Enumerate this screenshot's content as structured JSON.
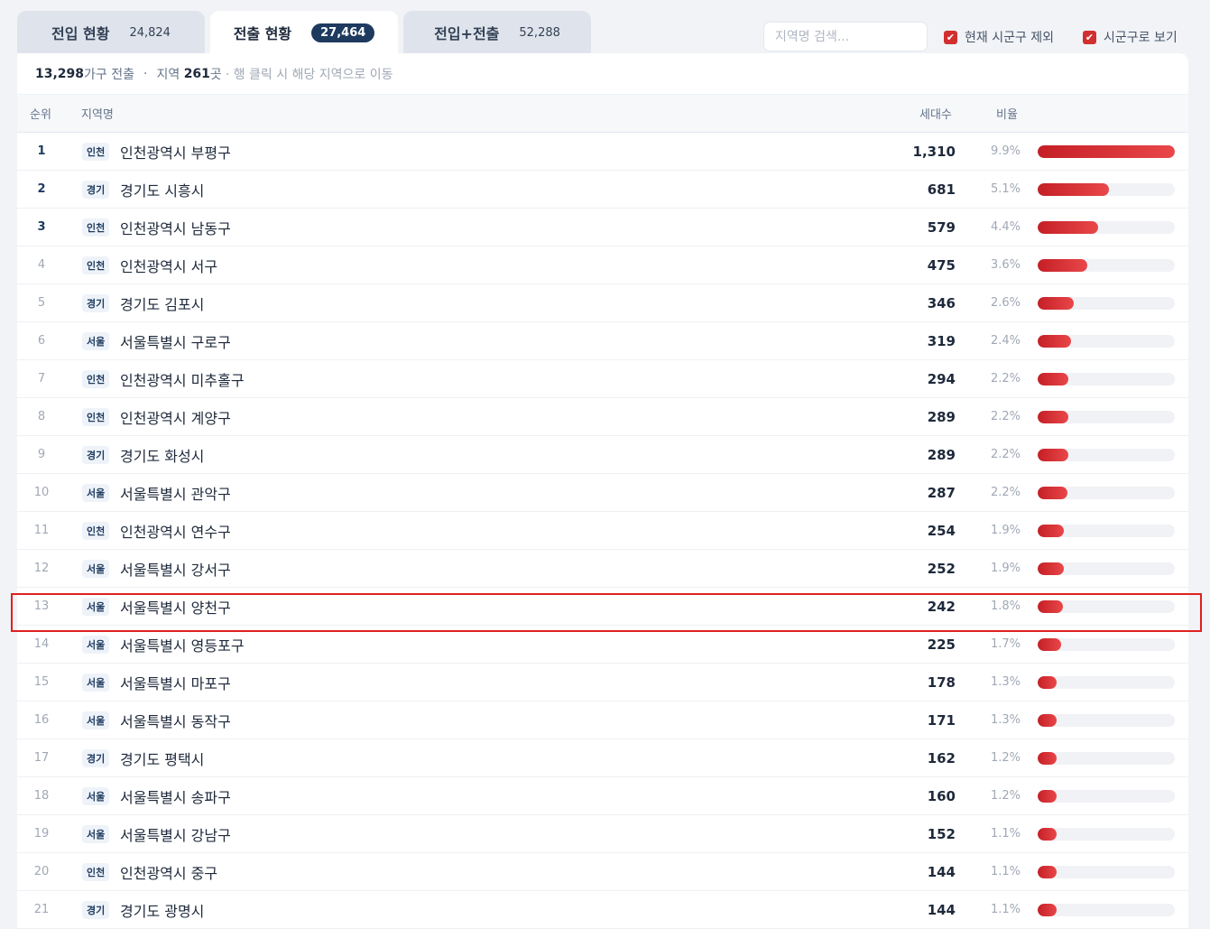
{
  "tabs": [
    {
      "label": "전입 현황",
      "count": "24,824"
    },
    {
      "label": "전출 현황",
      "count": "27,464",
      "active": true
    },
    {
      "label": "전입+전출",
      "count": "52,288"
    }
  ],
  "search": {
    "placeholder": "지역명 검색..."
  },
  "filters": [
    {
      "label": "현재 시군구 제외",
      "checked": true
    },
    {
      "label": "시군구로 보기",
      "checked": true
    }
  ],
  "summary": {
    "households": "13,298",
    "households_suffix": "가구 전출",
    "sep": "·",
    "region_prefix": "지역",
    "regions": "261",
    "region_suffix": "곳",
    "hint": "· 행 클릭 시 해당 지역으로 이동"
  },
  "columns": {
    "rank": "순위",
    "name": "지역명",
    "count": "세대수",
    "ratio": "비율"
  },
  "max_value": 1310,
  "rows": [
    {
      "rank": "1",
      "badge": "인천",
      "name": "인천광역시 부평구",
      "value": 1310,
      "value_label": "1,310",
      "pct": "9.9%"
    },
    {
      "rank": "2",
      "badge": "경기",
      "name": "경기도 시흥시",
      "value": 681,
      "value_label": "681",
      "pct": "5.1%"
    },
    {
      "rank": "3",
      "badge": "인천",
      "name": "인천광역시 남동구",
      "value": 579,
      "value_label": "579",
      "pct": "4.4%"
    },
    {
      "rank": "4",
      "badge": "인천",
      "name": "인천광역시 서구",
      "value": 475,
      "value_label": "475",
      "pct": "3.6%"
    },
    {
      "rank": "5",
      "badge": "경기",
      "name": "경기도 김포시",
      "value": 346,
      "value_label": "346",
      "pct": "2.6%"
    },
    {
      "rank": "6",
      "badge": "서울",
      "name": "서울특별시 구로구",
      "value": 319,
      "value_label": "319",
      "pct": "2.4%"
    },
    {
      "rank": "7",
      "badge": "인천",
      "name": "인천광역시 미추홀구",
      "value": 294,
      "value_label": "294",
      "pct": "2.2%"
    },
    {
      "rank": "8",
      "badge": "인천",
      "name": "인천광역시 계양구",
      "value": 289,
      "value_label": "289",
      "pct": "2.2%"
    },
    {
      "rank": "9",
      "badge": "경기",
      "name": "경기도 화성시",
      "value": 289,
      "value_label": "289",
      "pct": "2.2%"
    },
    {
      "rank": "10",
      "badge": "서울",
      "name": "서울특별시 관악구",
      "value": 287,
      "value_label": "287",
      "pct": "2.2%"
    },
    {
      "rank": "11",
      "badge": "인천",
      "name": "인천광역시 연수구",
      "value": 254,
      "value_label": "254",
      "pct": "1.9%"
    },
    {
      "rank": "12",
      "badge": "서울",
      "name": "서울특별시 강서구",
      "value": 252,
      "value_label": "252",
      "pct": "1.9%"
    },
    {
      "rank": "13",
      "badge": "서울",
      "name": "서울특별시 양천구",
      "value": 242,
      "value_label": "242",
      "pct": "1.8%"
    },
    {
      "rank": "14",
      "badge": "서울",
      "name": "서울특별시 영등포구",
      "value": 225,
      "value_label": "225",
      "pct": "1.7%"
    },
    {
      "rank": "15",
      "badge": "서울",
      "name": "서울특별시 마포구",
      "value": 178,
      "value_label": "178",
      "pct": "1.3%"
    },
    {
      "rank": "16",
      "badge": "서울",
      "name": "서울특별시 동작구",
      "value": 171,
      "value_label": "171",
      "pct": "1.3%"
    },
    {
      "rank": "17",
      "badge": "경기",
      "name": "경기도 평택시",
      "value": 162,
      "value_label": "162",
      "pct": "1.2%"
    },
    {
      "rank": "18",
      "badge": "서울",
      "name": "서울특별시 송파구",
      "value": 160,
      "value_label": "160",
      "pct": "1.2%"
    },
    {
      "rank": "19",
      "badge": "서울",
      "name": "서울특별시 강남구",
      "value": 152,
      "value_label": "152",
      "pct": "1.1%"
    },
    {
      "rank": "20",
      "badge": "인천",
      "name": "인천광역시 중구",
      "value": 144,
      "value_label": "144",
      "pct": "1.1%"
    },
    {
      "rank": "21",
      "badge": "경기",
      "name": "경기도 광명시",
      "value": 144,
      "value_label": "144",
      "pct": "1.1%"
    }
  ]
}
